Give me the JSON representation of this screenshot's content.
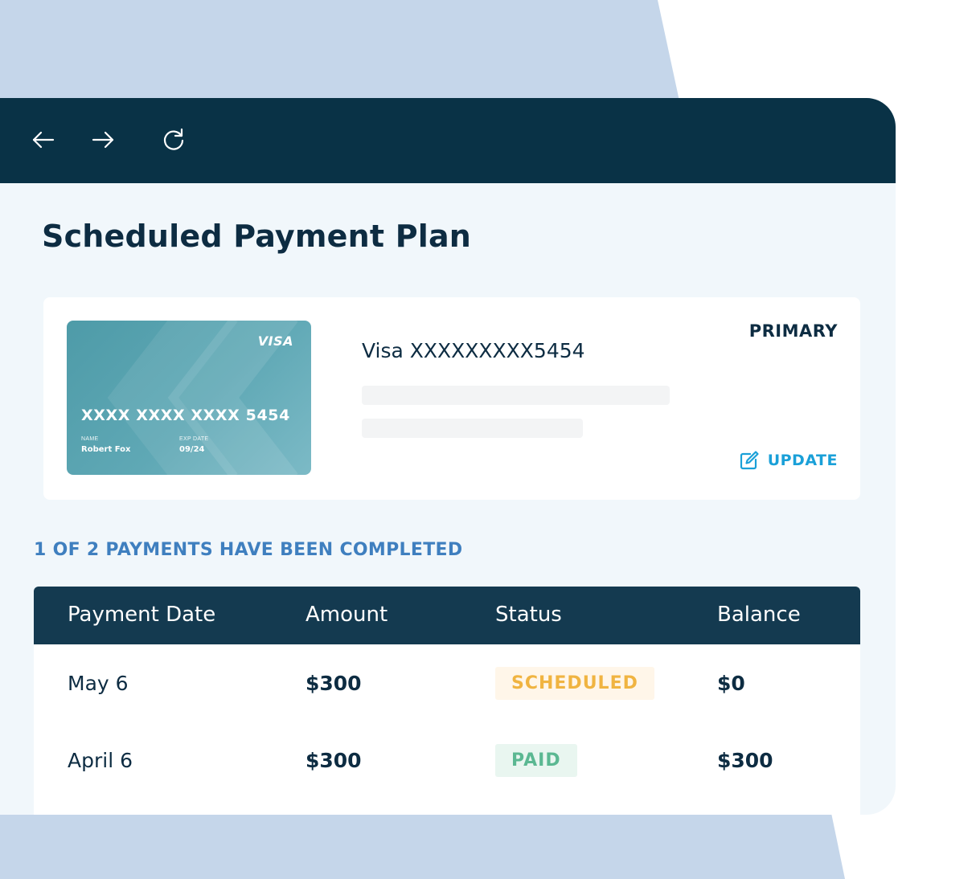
{
  "colors": {
    "background_shape": "#c5d6ea",
    "window_background": "#f1f7fb",
    "titlebar": "#093246",
    "table_header": "#143a50",
    "heading_text": "#0d2c42",
    "progress_text": "#3f7fbf",
    "update_accent": "#1aa0d8",
    "scheduled_text": "#f0b441",
    "scheduled_bg": "#fff6e9",
    "paid_text": "#5bb892",
    "paid_bg": "#e9f6f0"
  },
  "browser": {
    "back_icon": "arrow-left-icon",
    "forward_icon": "arrow-right-icon",
    "reload_icon": "reload-icon"
  },
  "page": {
    "title": "Scheduled Payment Plan"
  },
  "payment_method": {
    "card": {
      "brand": "VISA",
      "number": "XXXX XXXX XXXX 5454",
      "name_label": "NAME",
      "name": "Robert Fox",
      "exp_label": "EXP DATE",
      "exp": "09/24"
    },
    "title": "Visa XXXXXXXXX5454",
    "primary_label": "PRIMARY",
    "update_label": "UPDATE",
    "update_icon": "edit-icon"
  },
  "progress": {
    "text": "1 OF 2 PAYMENTS HAVE BEEN COMPLETED"
  },
  "table": {
    "headers": [
      "Payment Date",
      "Amount",
      "Status",
      "Balance"
    ],
    "rows": [
      {
        "date": "May 6",
        "amount": "$300",
        "status": "SCHEDULED",
        "balance": "$0"
      },
      {
        "date": "April 6",
        "amount": "$300",
        "status": "PAID",
        "balance": "$300"
      }
    ]
  }
}
